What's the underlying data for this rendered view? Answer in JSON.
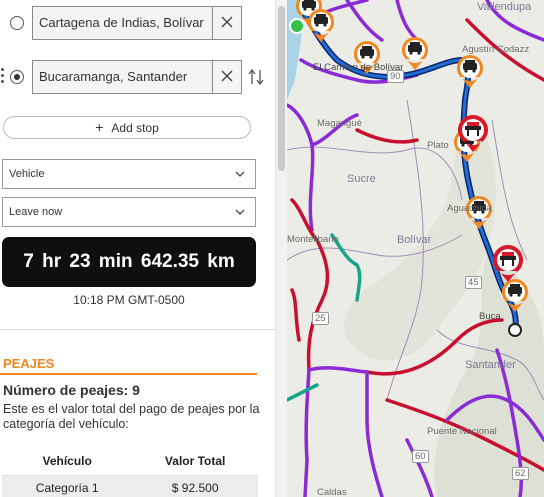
{
  "stops": [
    {
      "value": "Cartagena de Indias, Bolívar",
      "selected": false
    },
    {
      "value": "Bucaramanga, Santander",
      "selected": true
    }
  ],
  "add_stop_label": "Add stop",
  "vehicle_select": "Vehicle",
  "time_select": "Leave now",
  "summary": {
    "duration": "7 hr 23 min",
    "distance": "642.35 km"
  },
  "arrival_time": "10:18 PM GMT-0500",
  "peajes": {
    "title": "PEAJES",
    "count_text": "Número de peajes: 9",
    "description": "Este es el valor total del pago de peajes por la categoría del vehículo:",
    "table_headers": [
      "Vehículo",
      "Valor Total"
    ],
    "rows": [
      [
        "Categoría 1",
        "$ 92.500"
      ]
    ]
  },
  "map": {
    "place_labels": [
      "Vallendupa",
      "Agustín Codazz",
      "El Carmen de Bolívar",
      "Sucre",
      "Bolívar",
      "Montelibano",
      "Buca",
      "Santander",
      "Puente Nacional",
      "Caldas",
      "Magangué",
      "Plato",
      "Aguachica"
    ],
    "road_shields": [
      "25",
      "45",
      "60",
      "62",
      "90"
    ],
    "colors": {
      "route": "#1f6fd1",
      "congestion_heavy": "#c8102e",
      "congestion_moderate": "#8a2bd6",
      "free_flow": "#1aa38b",
      "toll_marker": "#f0871f",
      "closure_marker": "#d7192a"
    }
  }
}
